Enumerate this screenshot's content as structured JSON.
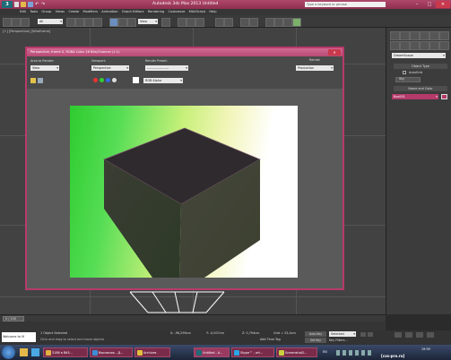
{
  "window": {
    "title": "Autodesk 3ds Max 2013     Untitled",
    "app_logo": "3",
    "search_placeholder": "Type a keyword or phrase",
    "minimize": "–",
    "maximize": "□",
    "close": "✕"
  },
  "menu": [
    "Edit",
    "Tools",
    "Group",
    "Views",
    "Create",
    "Modifiers",
    "Animation",
    "Graph Editors",
    "Rendering",
    "Customize",
    "MAXScript",
    "Help"
  ],
  "toolbar": {
    "selection_filter": "All",
    "view_dropdown": "View"
  },
  "viewport": {
    "label": "[+] [Perspective] [Wireframe]"
  },
  "render_window": {
    "title": "Perspective, frame 0, RGBA Color 16 Bits/Channel (1:1)",
    "area_to_render_label": "Area to Render:",
    "area_to_render_value": "View",
    "viewport_label": "Viewport:",
    "viewport_value": "Perspective",
    "render_preset_label": "Render Preset:",
    "render_preset_value": "--------------------",
    "render_button": "Render",
    "render_mode_value": "Production",
    "channel_value": "RGB Alpha"
  },
  "command_panel": {
    "category_value": "DreamScape",
    "object_type_header": "Object Type",
    "autogrid_label": "AutoGrid",
    "sky_label": "Sky",
    "name_color_header": "Name and Color",
    "name_value": "Box001"
  },
  "timeline": {
    "frame_counter": "0 / 100"
  },
  "status": {
    "maxscript_listener": "Welcome to M",
    "selection_status": "1 Object Selected",
    "prompt": "Click and drag to select and move objects",
    "x": "X: -96,299cm",
    "y": "Y: -0,007cm",
    "z": "Z: 0,794cm",
    "grid": "Grid = 25,4cm",
    "auto_key": "Auto Key",
    "selected": "Selected",
    "set_key": "Set Key",
    "key_filters": "Key Filters...",
    "add_time_tag": "Add Time Tag"
  },
  "taskbar": {
    "tasks": [
      "3186 в Bit3...",
      "Вернисаж - Д...",
      "Archives",
      "Untitled - A...",
      "Skype™ - art...",
      "Screenshot2..."
    ],
    "language": "EN",
    "clock": "19:59",
    "watermark": "[css-pro.ru]"
  }
}
